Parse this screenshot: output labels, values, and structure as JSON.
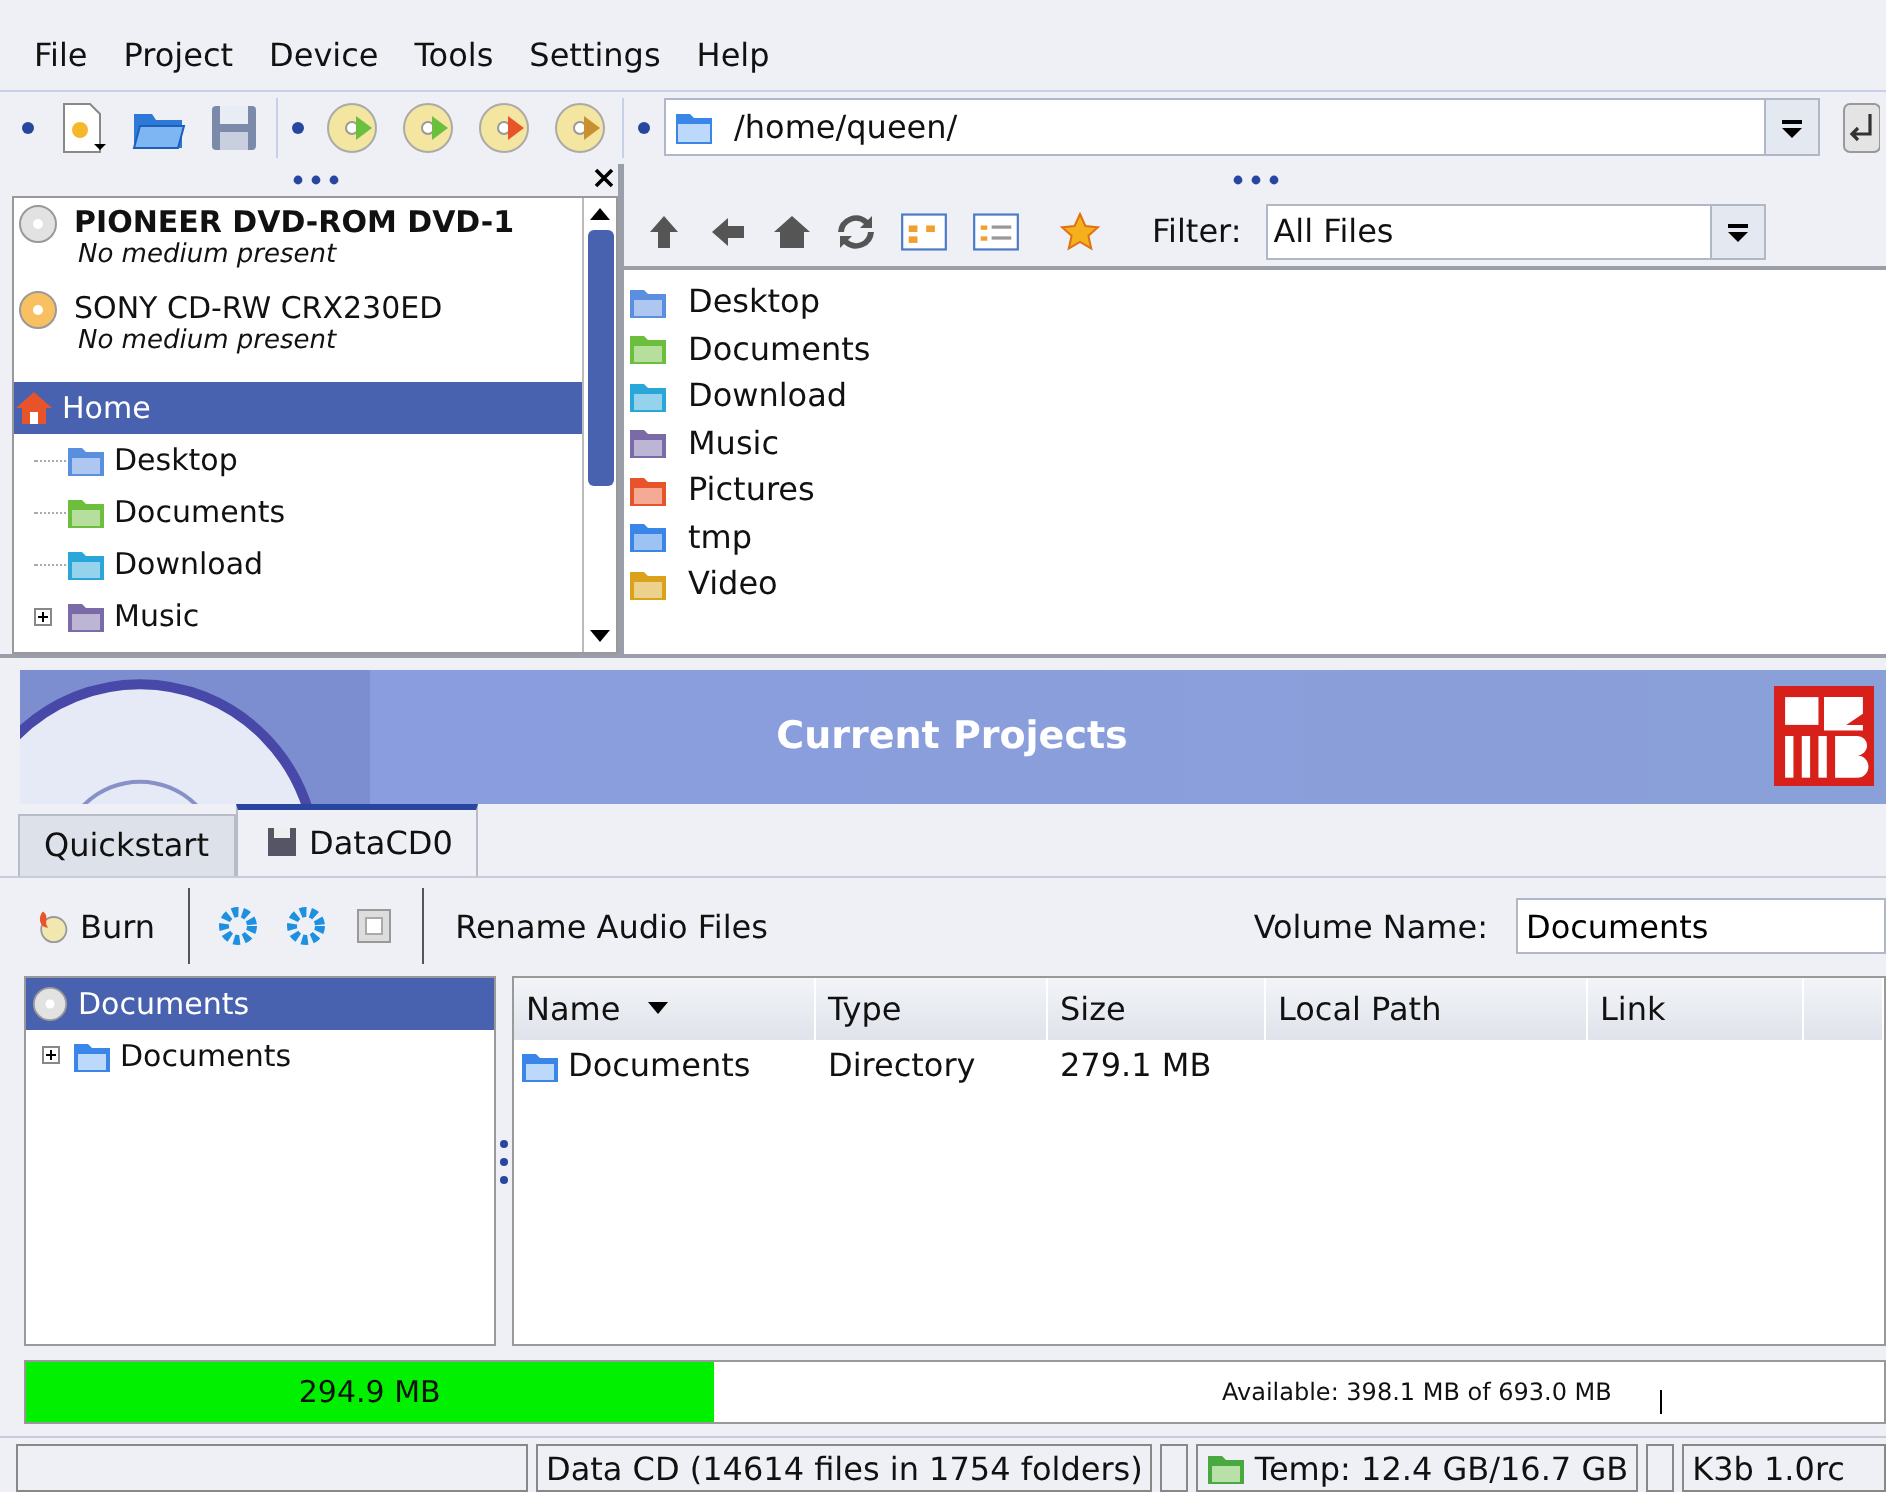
{
  "menu": [
    "File",
    "Project",
    "Device",
    "Tools",
    "Settings",
    "Help"
  ],
  "location": {
    "value": "/home/queen/"
  },
  "devices": [
    {
      "name": "PIONEER DVD-ROM DVD-1",
      "status": "No medium present",
      "kind": "dvd",
      "bold": true
    },
    {
      "name": "SONY CD-RW  CRX230ED",
      "status": "No medium present",
      "kind": "cdrw",
      "bold": false
    }
  ],
  "dir_tree": {
    "label": "Home",
    "selected": true,
    "children": [
      {
        "label": "Desktop",
        "kind": "desktop",
        "expandable": false
      },
      {
        "label": "Documents",
        "kind": "documents",
        "expandable": false
      },
      {
        "label": "Download",
        "kind": "download",
        "expandable": false
      },
      {
        "label": "Music",
        "kind": "music",
        "expandable": true
      }
    ]
  },
  "filter": {
    "label": "Filter:",
    "value": "All Files"
  },
  "files": [
    {
      "name": "Desktop",
      "kind": "desktop"
    },
    {
      "name": "Documents",
      "kind": "documents"
    },
    {
      "name": "Download",
      "kind": "download"
    },
    {
      "name": "Music",
      "kind": "music"
    },
    {
      "name": "Pictures",
      "kind": "pictures"
    },
    {
      "name": "tmp",
      "kind": "folder"
    },
    {
      "name": "Video",
      "kind": "video"
    }
  ],
  "banner": {
    "title": "Current Projects"
  },
  "tabs": [
    {
      "label": "Quickstart",
      "selected": false,
      "icon": false
    },
    {
      "label": "DataCD0",
      "selected": true,
      "icon": true
    }
  ],
  "project_toolbar": {
    "burn": "Burn",
    "rename": "Rename Audio Files",
    "volume_label": "Volume Name:",
    "volume_value": "Documents"
  },
  "project_tree": {
    "label": "Documents",
    "selected": true,
    "children": [
      {
        "label": "Documents"
      }
    ]
  },
  "table": {
    "columns": [
      "Name",
      "Type",
      "Size",
      "Local Path",
      "Link"
    ],
    "rows": [
      [
        "Documents",
        "Directory",
        "279.1 MB"
      ]
    ]
  },
  "usage": {
    "used": "294.9 MB",
    "level": 0.37,
    "available": "Available: 398.1 MB of 693.0 MB"
  },
  "status_bar": [
    "Data CD (14614 files in 1754 folders)",
    "Temp: 12.4 GB/16.7 GB",
    "K3b 1.0rc"
  ]
}
